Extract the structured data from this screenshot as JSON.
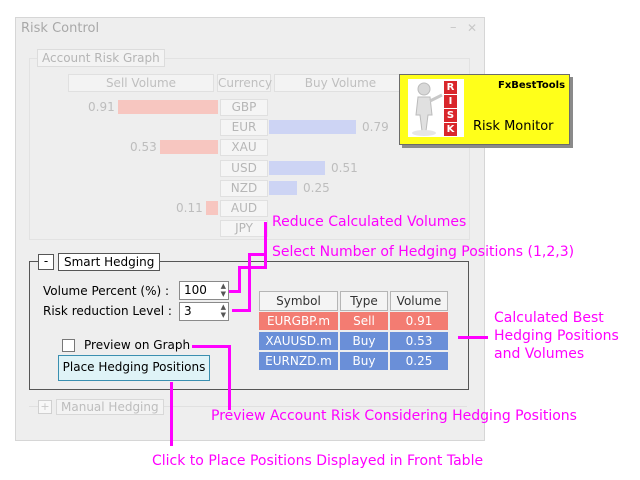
{
  "window": {
    "title": "Risk Control",
    "minimize_label": "–",
    "close_label": "✕"
  },
  "risk_graph": {
    "label": "Account Risk Graph",
    "headers": {
      "sell": "Sell Volume",
      "currency": "Currency",
      "buy": "Buy Volume"
    },
    "rows": [
      {
        "currency": "GBP",
        "sell": 0.91,
        "sell_label": "0.91",
        "buy": null,
        "buy_label": ""
      },
      {
        "currency": "EUR",
        "sell": null,
        "sell_label": "",
        "buy": 0.79,
        "buy_label": "0.79"
      },
      {
        "currency": "XAU",
        "sell": 0.53,
        "sell_label": "0.53",
        "buy": null,
        "buy_label": ""
      },
      {
        "currency": "USD",
        "sell": null,
        "sell_label": "",
        "buy": 0.51,
        "buy_label": "0.51"
      },
      {
        "currency": "NZD",
        "sell": null,
        "sell_label": "",
        "buy": 0.25,
        "buy_label": "0.25"
      },
      {
        "currency": "AUD",
        "sell": 0.11,
        "sell_label": "0.11",
        "buy": null,
        "buy_label": ""
      },
      {
        "currency": "JPY",
        "sell": null,
        "sell_label": "",
        "buy": null,
        "buy_label": ""
      }
    ]
  },
  "smart_hedging": {
    "label": "Smart Hedging",
    "collapse_symbol": "-",
    "volume_percent_label": "Volume Percent (%) :",
    "volume_percent_value": "100",
    "risk_level_label": "Risk reduction Level :",
    "risk_level_value": "3",
    "preview_label": "Preview on Graph",
    "place_button_label": "Place Hedging Positions",
    "table": {
      "headers": [
        "Symbol",
        "Type",
        "Volume"
      ],
      "rows": [
        {
          "symbol": "EURGBP.m",
          "type": "Sell",
          "volume": "0.91"
        },
        {
          "symbol": "XAUUSD.m",
          "type": "Buy",
          "volume": "0.53"
        },
        {
          "symbol": "EURNZD.m",
          "type": "Buy",
          "volume": "0.25"
        }
      ]
    }
  },
  "manual_hedging": {
    "label": "Manual Hedging",
    "collapse_symbol": "+"
  },
  "logo": {
    "brand": "FxBestTools",
    "title": "Risk Monitor",
    "letters": [
      "R",
      "I",
      "S",
      "K"
    ]
  },
  "annotations": {
    "reduce": "Reduce Calculated Volumes",
    "select": "Select Number of Hedging Positions (1,2,3)",
    "calculated": [
      "Calculated Best",
      "Hedging Positions",
      "and Volumes"
    ],
    "preview": "Preview Account Risk Considering Hedging Positions",
    "click": "Click to Place Positions Displayed in Front Table"
  },
  "colors": {
    "annotation": "#ff00ff",
    "sell_row": "#f37c72",
    "buy_row": "#6a8fd8",
    "sell_bar": "#f7c6c0",
    "buy_bar": "#cdd4f4",
    "logo_bg": "#ffff1a"
  }
}
